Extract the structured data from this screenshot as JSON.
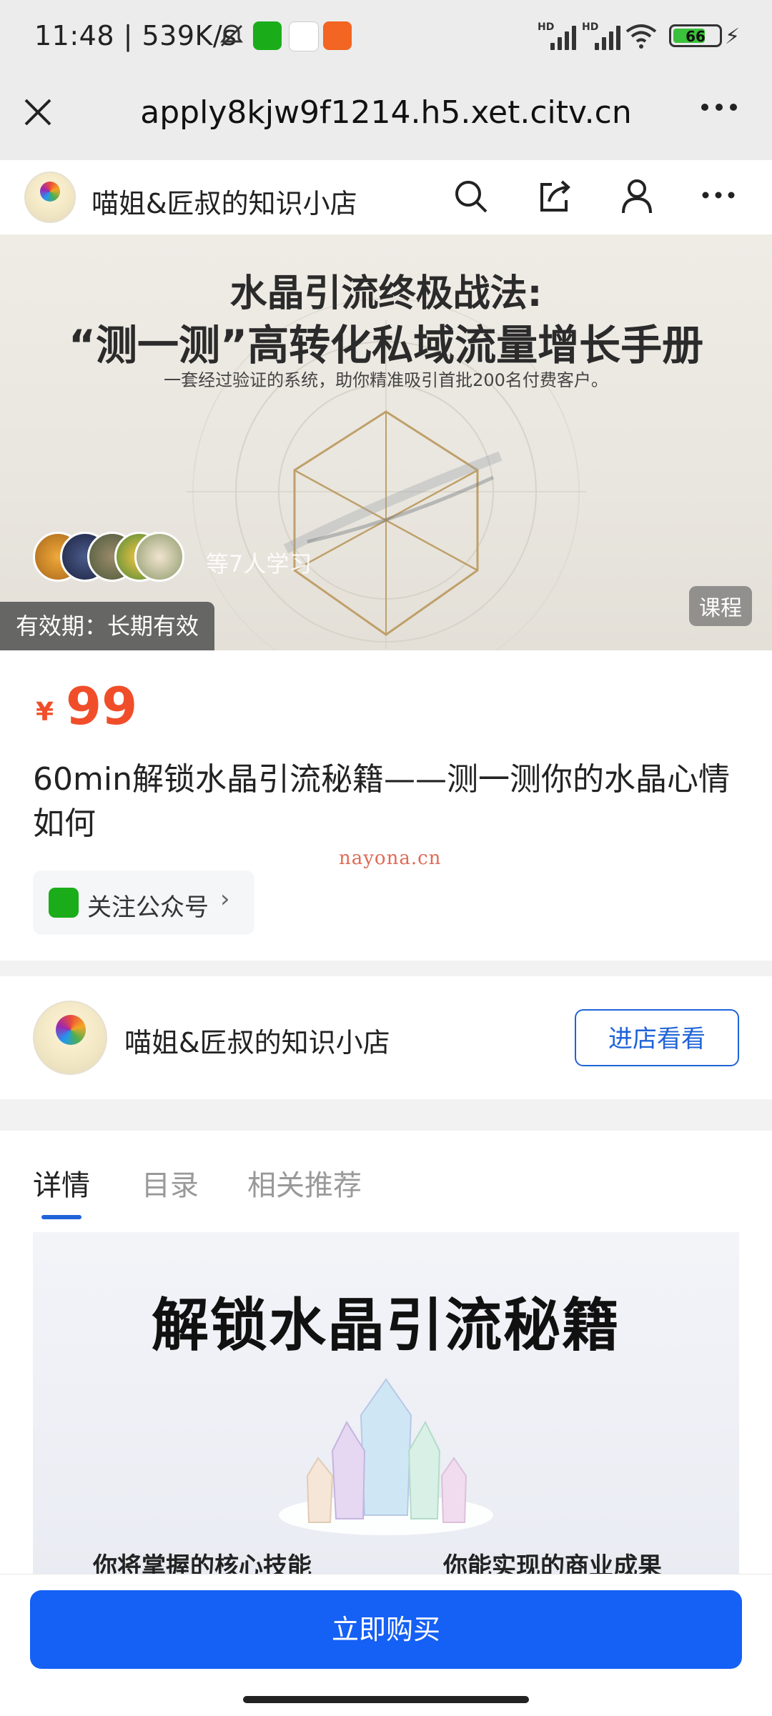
{
  "status_bar": {
    "time": "11:48 | 539K/s",
    "hd_1": "HD",
    "hd_2": "HD",
    "battery": "66"
  },
  "browser": {
    "url": "apply8kjw9f1214.h5.xet.citv.cn"
  },
  "header": {
    "shop_name": "喵姐&匠叔的知识小店"
  },
  "banner": {
    "headline_line1": "水晶引流终极战法:",
    "headline_line2": "“测一测”高转化私域流量增长手册",
    "tagline": "一套经过验证的系统，助你精准吸引首批200名付费客户。",
    "learned_text": "等7人学习",
    "validity": "有效期：长期有效",
    "course_tag": "课程"
  },
  "product": {
    "currency": "¥",
    "price": "99",
    "title": "60min解锁水晶引流秘籍——测一测你的水晶心情如何",
    "follow_label": "关注公众号",
    "watermark": "nayona.cn"
  },
  "shop": {
    "name": "喵姐&匠叔的知识小店",
    "enter_label": "进店看看"
  },
  "tabs": [
    {
      "label": "详情"
    },
    {
      "label": "目录"
    },
    {
      "label": "相关推荐"
    }
  ],
  "poster": {
    "title": "解锁水晶引流秘籍",
    "left_heading": "你将掌握的核心技能",
    "right_heading": "你能实现的商业成果"
  },
  "footer": {
    "buy_label": "立即购买"
  },
  "colors": {
    "accent": "#1560f5",
    "price": "#f04e2a",
    "wechat": "#1aad19"
  }
}
